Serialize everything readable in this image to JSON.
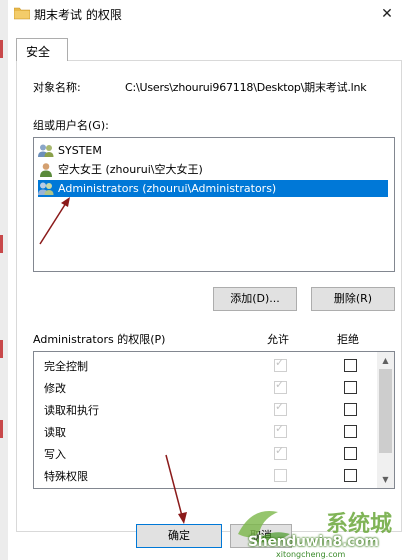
{
  "window": {
    "title": "期末考试 的权限",
    "close_glyph": "✕",
    "folder_color": "#e8b84a"
  },
  "tabs": [
    {
      "label": "安全"
    }
  ],
  "object": {
    "label": "对象名称:",
    "path": "C:\\Users\\zhourui967118\\Desktop\\期末考试.lnk"
  },
  "groups": {
    "label": "组或用户名(G):",
    "items": [
      {
        "name": "SYSTEM",
        "icon": "group-users-icon"
      },
      {
        "name": "空大女王 (zhourui\\空大女王)",
        "icon": "user-icon"
      },
      {
        "name": "Administrators (zhourui\\Administrators)",
        "icon": "group-users-icon",
        "selected": true
      }
    ],
    "add_label": "添加(D)...",
    "remove_label": "删除(R)"
  },
  "permissions": {
    "label": "Administrators 的权限(P)",
    "allow_header": "允许",
    "deny_header": "拒绝",
    "rows": [
      {
        "name": "完全控制",
        "allow": true,
        "deny": false
      },
      {
        "name": "修改",
        "allow": true,
        "deny": false
      },
      {
        "name": "读取和执行",
        "allow": true,
        "deny": false
      },
      {
        "name": "读取",
        "allow": true,
        "deny": false
      },
      {
        "name": "写入",
        "allow": true,
        "deny": false
      },
      {
        "name": "特殊权限",
        "allow": false,
        "deny": false
      }
    ]
  },
  "footer": {
    "ok_label": "确定",
    "cancel_label": "取消"
  },
  "watermark": {
    "main": "Shenduwin8.com",
    "url": "xitongcheng.com",
    "cn": "系统城"
  },
  "colors": {
    "selection": "#0078d7",
    "arrow": "#8b1a1a"
  }
}
